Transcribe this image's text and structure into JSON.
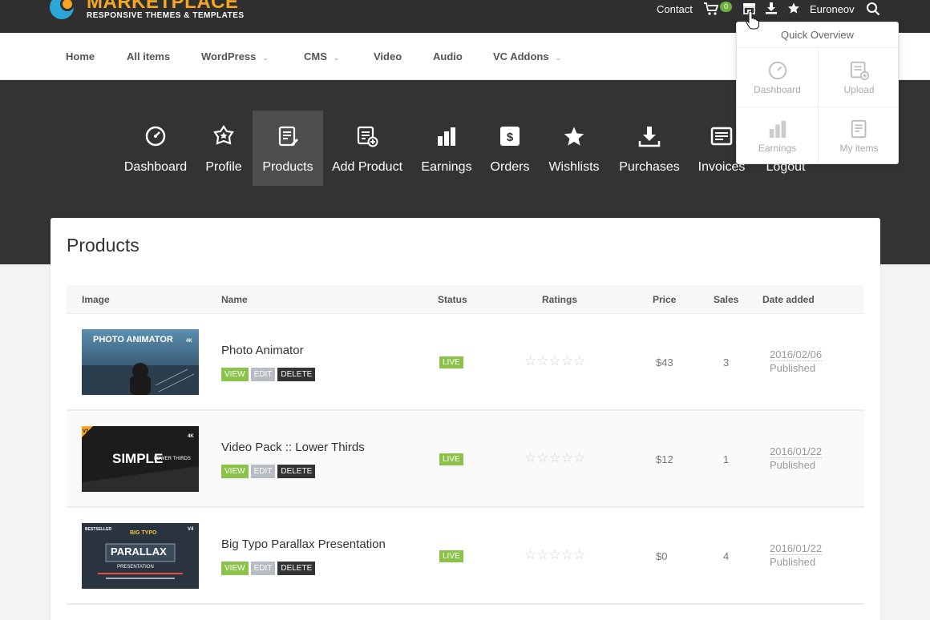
{
  "brand": {
    "title": "MARKETPLACE",
    "subtitle": "RESPONSIVE THEMES & TEMPLATES"
  },
  "topbar": {
    "contact": "Contact",
    "cart_count": "0",
    "user": "Euroneov"
  },
  "nav": {
    "items": [
      {
        "label": "Home",
        "has_dropdown": false
      },
      {
        "label": "All items",
        "has_dropdown": false
      },
      {
        "label": "WordPress",
        "has_dropdown": true
      },
      {
        "label": "CMS",
        "has_dropdown": true
      },
      {
        "label": "Video",
        "has_dropdown": false
      },
      {
        "label": "Audio",
        "has_dropdown": false
      },
      {
        "label": "VC Addons",
        "has_dropdown": true
      }
    ],
    "caret": "⌄"
  },
  "dashboard_menu": {
    "items": [
      {
        "label": "Dashboard",
        "icon": "gauge-icon"
      },
      {
        "label": "Profile",
        "icon": "star-badge-icon"
      },
      {
        "label": "Products",
        "icon": "list-edit-icon",
        "active": true
      },
      {
        "label": "Add Product",
        "icon": "list-add-icon"
      },
      {
        "label": "Earnings",
        "icon": "bar-chart-icon"
      },
      {
        "label": "Orders",
        "icon": "dollar-icon"
      },
      {
        "label": "Wishlists",
        "icon": "star-icon"
      },
      {
        "label": "Purchases",
        "icon": "download-icon"
      },
      {
        "label": "Invoices",
        "icon": "invoice-icon"
      },
      {
        "label": "Logout",
        "icon": "logout-icon"
      }
    ]
  },
  "products": {
    "title": "Products",
    "columns": [
      "Image",
      "Name",
      "Status",
      "Ratings",
      "Price",
      "Sales",
      "Date added"
    ],
    "actions": {
      "view": "VIEW",
      "edit": "EDIT",
      "delete": "DELETE"
    },
    "rows": [
      {
        "name": "Photo Animator",
        "status": "LIVE",
        "rating": 0,
        "price": "$43",
        "sales": "3",
        "date": "2016/02/06",
        "state": "Published",
        "thumb_text": "PHOTO ANIMATOR",
        "thumb_badge": "4K"
      },
      {
        "name": "Video Pack :: Lower Thirds",
        "status": "LIVE",
        "rating": 0,
        "price": "$12",
        "sales": "1",
        "date": "2016/01/22",
        "state": "Published",
        "thumb_text": "SIMPLE",
        "thumb_text2": "LOWER THIRDS",
        "thumb_badge": "4K",
        "corner_badge": "V3"
      },
      {
        "name": "Big Typo Parallax Presentation",
        "status": "LIVE",
        "rating": 0,
        "price": "$0",
        "sales": "4",
        "date": "2016/01/22",
        "state": "Published",
        "thumb_text": "PARALLAX",
        "thumb_text2": "PRESENTATION",
        "thumb_text3": "BIG TYPO",
        "thumb_badge": "V4",
        "corner_badge": "BESTSELLER"
      }
    ]
  },
  "quick_overview": {
    "title": "Quick Overview",
    "items": [
      {
        "label": "Dashboard",
        "icon": "gauge-icon"
      },
      {
        "label": "Upload",
        "icon": "list-add-icon"
      },
      {
        "label": "Earnings",
        "icon": "bar-chart-icon"
      },
      {
        "label": "My items",
        "icon": "list-edit-icon"
      }
    ]
  },
  "colors": {
    "accent": "#8bc34a",
    "brand": "#f5a623",
    "dark": "#333333"
  }
}
